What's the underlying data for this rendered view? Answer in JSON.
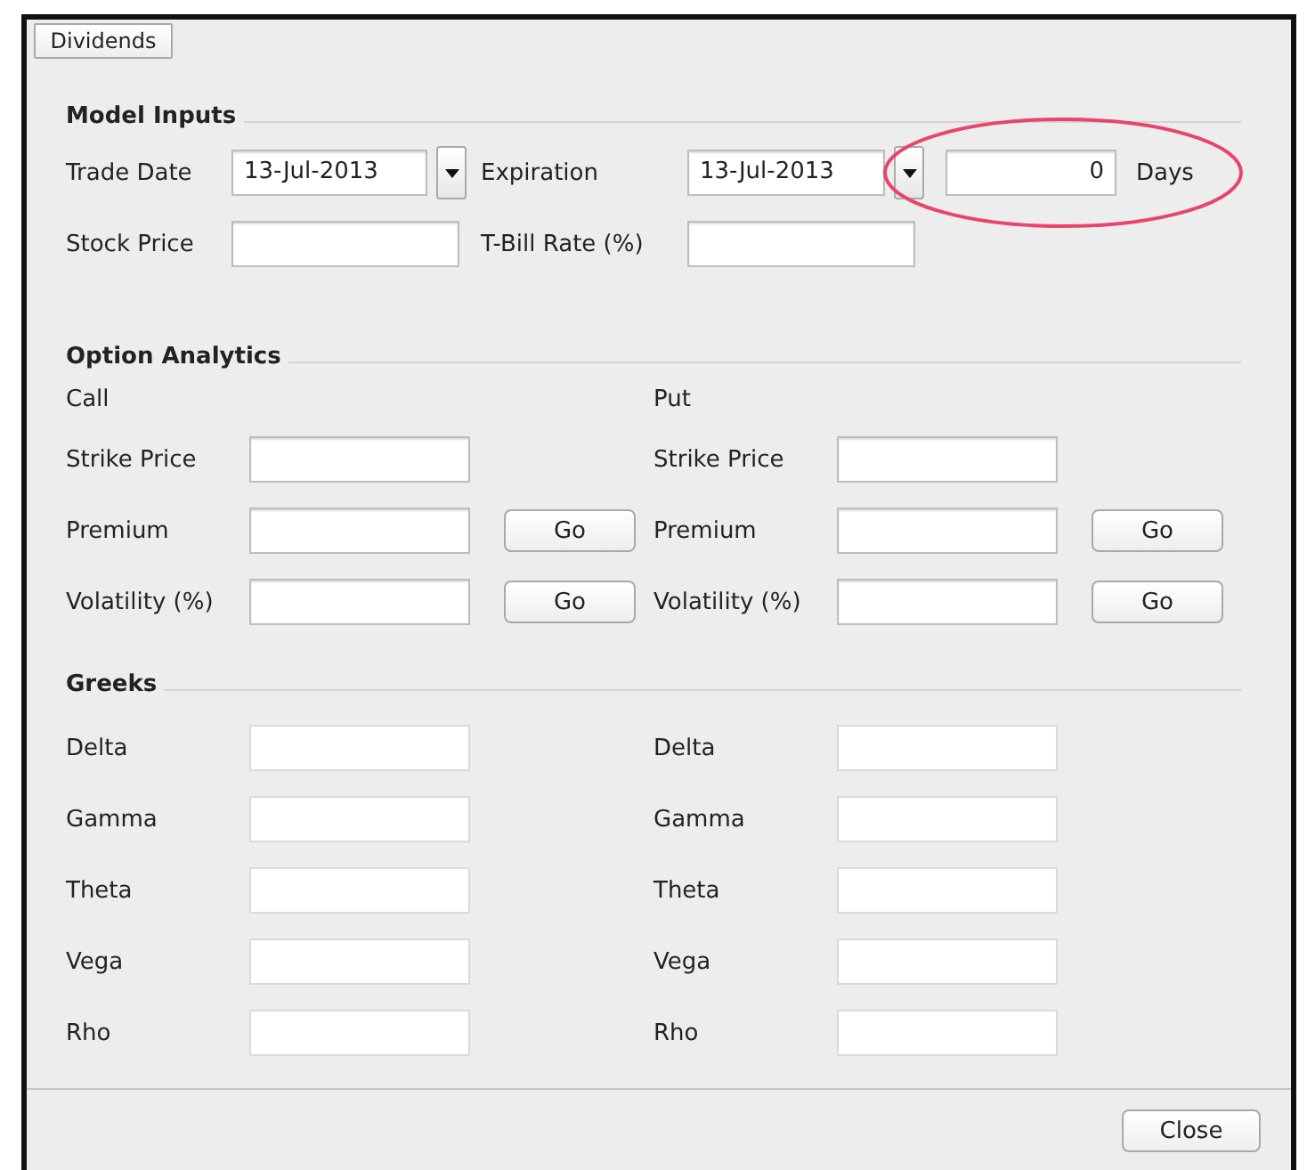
{
  "dividends_button": "Dividends",
  "model_inputs": {
    "title": "Model Inputs",
    "trade_date": {
      "label": "Trade Date",
      "value": "13-Jul-2013"
    },
    "expiration": {
      "label": "Expiration",
      "value": "13-Jul-2013"
    },
    "days": {
      "value": "0",
      "unit": "Days"
    },
    "stock_price": {
      "label": "Stock Price"
    },
    "tbill_rate": {
      "label": "T-Bill Rate (%)"
    }
  },
  "option_analytics": {
    "title": "Option Analytics",
    "columns": [
      {
        "heading": "Call",
        "rows": [
          {
            "label": "Strike Price"
          },
          {
            "label": "Premium",
            "button": "Go"
          },
          {
            "label": "Volatility (%)",
            "button": "Go"
          }
        ]
      },
      {
        "heading": "Put",
        "rows": [
          {
            "label": "Strike Price"
          },
          {
            "label": "Premium",
            "button": "Go"
          },
          {
            "label": "Volatility (%)",
            "button": "Go"
          }
        ]
      }
    ]
  },
  "greeks": {
    "title": "Greeks",
    "columns": [
      {
        "rows": [
          {
            "label": "Delta",
            "disabled": true
          },
          {
            "label": "Gamma",
            "disabled": true
          },
          {
            "label": "Theta",
            "disabled": true
          },
          {
            "label": "Vega",
            "disabled": true
          },
          {
            "label": "Rho",
            "disabled": true
          }
        ]
      },
      {
        "rows": [
          {
            "label": "Delta",
            "disabled": true
          },
          {
            "label": "Gamma",
            "disabled": true
          },
          {
            "label": "Theta",
            "disabled": true
          },
          {
            "label": "Vega",
            "disabled": true
          },
          {
            "label": "Rho",
            "disabled": true
          }
        ]
      }
    ]
  },
  "close_button": "Close"
}
